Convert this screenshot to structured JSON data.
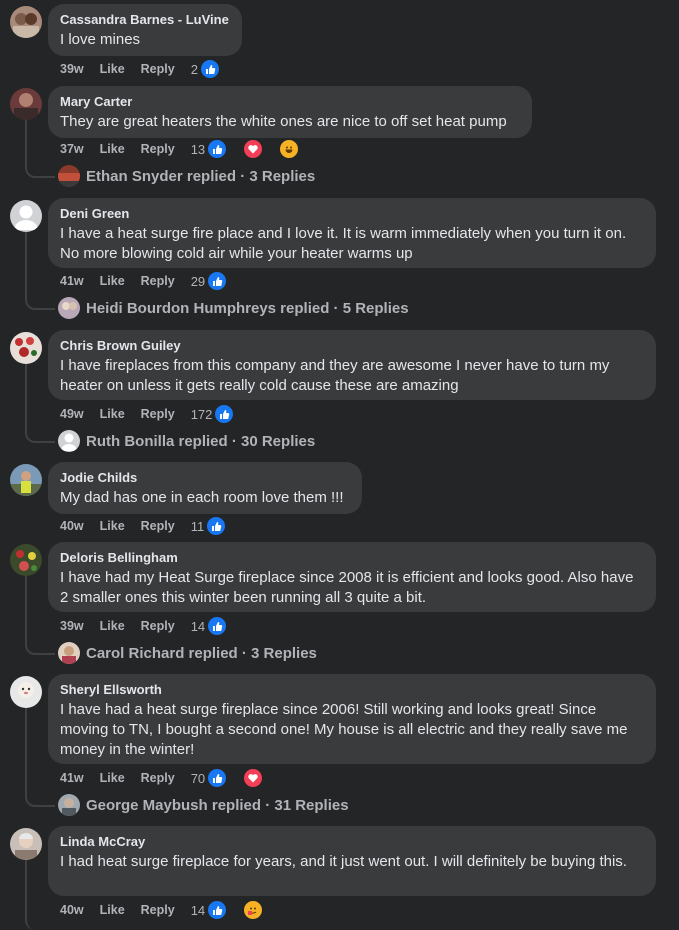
{
  "comments": [
    {
      "author": "Cassandra Barnes - LuVine",
      "text": "I love mines",
      "time": "39w",
      "like": "Like",
      "reply": "Reply",
      "count": "2",
      "reactions": [
        "like"
      ],
      "replies": null
    },
    {
      "author": "Mary Carter",
      "text": "They are great heaters the white ones are nice to off set heat pump",
      "time": "37w",
      "like": "Like",
      "reply": "Reply",
      "count": "13",
      "reactions": [
        "like",
        "love",
        "haha"
      ],
      "replies": "Ethan Snyder replied · 3 Replies"
    },
    {
      "author": "Deni Green",
      "text": "I have a heat surge fire place and I love it. It is warm immediately when you turn it on. No more blowing cold air while your heater warms up",
      "time": "41w",
      "like": "Like",
      "reply": "Reply",
      "count": "29",
      "reactions": [
        "like"
      ],
      "replies": "Heidi Bourdon Humphreys replied · 5 Replies"
    },
    {
      "author": "Chris Brown Guiley",
      "text": "I have fireplaces from this company and they are awesome I never have to turn my heater on unless it gets really cold cause these are amazing",
      "time": "49w",
      "like": "Like",
      "reply": "Reply",
      "count": "172",
      "reactions": [
        "like"
      ],
      "replies": "Ruth Bonilla replied · 30 Replies"
    },
    {
      "author": "Jodie Childs",
      "text": "My dad has one in each room love them !!!",
      "time": "40w",
      "like": "Like",
      "reply": "Reply",
      "count": "11",
      "reactions": [
        "like"
      ],
      "replies": null
    },
    {
      "author": "Deloris Bellingham",
      "text": "I have had my Heat Surge fireplace since 2008 it is efficient and looks good. Also have 2 smaller ones this winter been running all 3 quite a bit.",
      "time": "39w",
      "like": "Like",
      "reply": "Reply",
      "count": "14",
      "reactions": [
        "like"
      ],
      "replies": "Carol Richard replied · 3 Replies"
    },
    {
      "author": "Sheryl Ellsworth",
      "text": "I have had a heat surge fireplace since 2006! Still working and looks great! Since moving to TN, I bought a second one! My house is all electric and they really save me money in the winter!",
      "time": "41w",
      "like": "Like",
      "reply": "Reply",
      "count": "70",
      "reactions": [
        "like",
        "love"
      ],
      "replies": "George Maybush replied · 31 Replies"
    },
    {
      "author": "Linda McCray",
      "text": "I had heat surge fireplace for years, and it just went out. I will definitely be buying this.",
      "time": "40w",
      "like": "Like",
      "reply": "Reply",
      "count": "14",
      "reactions": [
        "like",
        "haha"
      ],
      "replies": null
    }
  ],
  "colors": {
    "like": "#1877f2",
    "love": "#f33e58",
    "haha": "#f7b125",
    "bubble": "#3a3b3c",
    "background": "#242526"
  }
}
